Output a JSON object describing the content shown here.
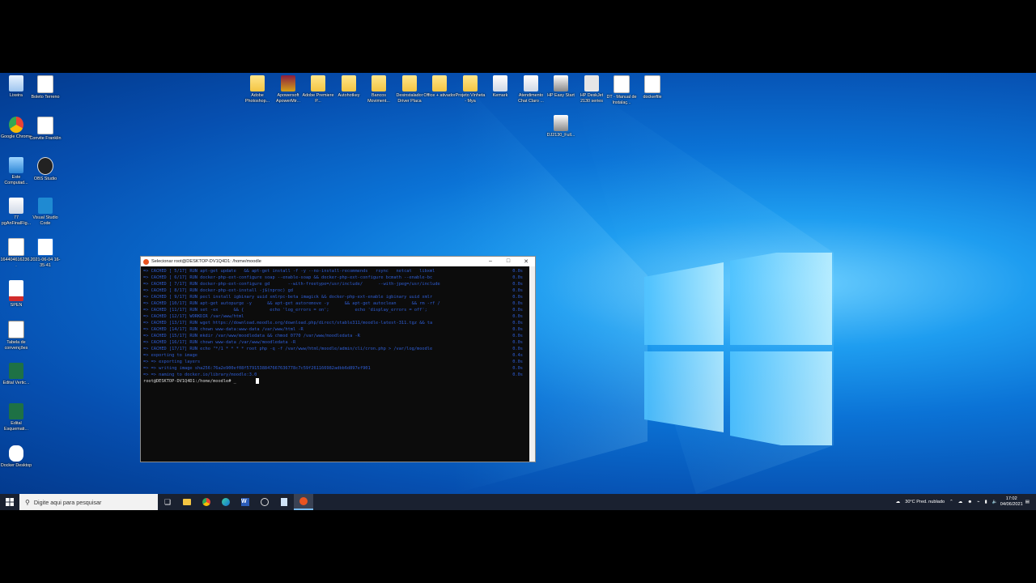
{
  "desktop_icons": [
    {
      "label": "Lixeira",
      "icon": "recycle-bin-icon"
    },
    {
      "label": "Boleto Terreno",
      "icon": "document-icon"
    },
    {
      "label": "Google Chrome",
      "icon": "chrome-icon"
    },
    {
      "label": "Convite Franklin",
      "icon": "document-icon"
    },
    {
      "label": "Este Computad...",
      "icon": "computer-icon"
    },
    {
      "label": "OBS Studio",
      "icon": "obs-icon"
    },
    {
      "label": "77 pgAnFinalFig...",
      "icon": "app-icon"
    },
    {
      "label": "Visual Studio Code",
      "icon": "vscode-icon"
    },
    {
      "label": "164404616236...",
      "icon": "document-icon"
    },
    {
      "label": "2021-06-04 16-35-41",
      "icon": "video-icon"
    },
    {
      "label": "SPEN",
      "icon": "pdf-icon"
    },
    {
      "label": "Tabela de convenções",
      "icon": "spreadsheet-icon"
    },
    {
      "label": "Edital Vertic...",
      "icon": "excel-icon"
    },
    {
      "label": "Edital Esquemati...",
      "icon": "excel-icon"
    },
    {
      "label": "Docker Desktop",
      "icon": "docker-icon"
    },
    {
      "label": "Adobe Photoshop...",
      "icon": "folder-icon"
    },
    {
      "label": "Apowersoft ApowerMir...",
      "icon": "winrar-icon"
    },
    {
      "label": "Adobe Premiere P...",
      "icon": "folder-icon"
    },
    {
      "label": "Autohotkey",
      "icon": "folder-icon"
    },
    {
      "label": "Bancos Moviment...",
      "icon": "folder-icon"
    },
    {
      "label": "Desinstalador Driver Placa",
      "icon": "folder-icon"
    },
    {
      "label": "Office + ativador",
      "icon": "folder-icon"
    },
    {
      "label": "Projeto Vinheta - Mya",
      "icon": "folder-icon"
    },
    {
      "label": "Kemark",
      "icon": "app-icon"
    },
    {
      "label": "Atendimento Chat Claro ...",
      "icon": "app-icon"
    },
    {
      "label": "HP Easy Start",
      "icon": "installer-icon"
    },
    {
      "label": "HP DeskJet 2130 series",
      "icon": "printer-icon"
    },
    {
      "label": "DT - Manual de Instalaç...",
      "icon": "document-icon"
    },
    {
      "label": "dockerfile",
      "icon": "document-icon"
    },
    {
      "label": "DJ2130_Full...",
      "icon": "installer-icon"
    }
  ],
  "terminal": {
    "title": "Selecionar root@DESKTOP-DV1Q4D1: /home/moodle",
    "lines": [
      {
        "text": "=> CACHED [ 5/17] RUN apt-get update   && apt-get install -f -y --no-install-recommends   rsync   netcat   libxml",
        "time": "0.0s"
      },
      {
        "text": "=> CACHED [ 6/17] RUN docker-php-ext-configure soap --enable-soap && docker-php-ext-configure bcmath --enable-bc",
        "time": "0.0s"
      },
      {
        "text": "=> CACHED [ 7/17] RUN docker-php-ext-configure gd       --with-freetype=/usr/include/      --with-jpeg=/usr/include",
        "time": "0.0s"
      },
      {
        "text": "=> CACHED [ 8/17] RUN docker-php-ext-install -j$(nproc) gd",
        "time": "0.0s"
      },
      {
        "text": "=> CACHED [ 9/17] RUN pecl install igbinary uuid xmlrpc-beta imagick && docker-php-ext-enable igbinary uuid xmlr",
        "time": "0.0s"
      },
      {
        "text": "=> CACHED [10/17] RUN apt-get autopurge -y      && apt-get autoremove -y      && apt-get autoclean      && rm -rf /",
        "time": "0.0s"
      },
      {
        "text": "=> CACHED [11/17] RUN set -ex      && {          echo 'log_errors = on';          echo 'display_errors = off';",
        "time": "0.0s"
      },
      {
        "text": "=> CACHED [12/17] WORKDIR /var/www/html",
        "time": "0.0s"
      },
      {
        "text": "=> CACHED [13/17] RUN wget https://download.moodle.org/download.php/direct/stable311/moodle-latest-311.tgz && ta",
        "time": "0.0s"
      },
      {
        "text": "=> CACHED [14/17] RUN chown www-data:www-data /var/www/html -R",
        "time": "0.0s"
      },
      {
        "text": "=> CACHED [15/17] RUN mkdir /var/www/moodledata && chmod 0770 /var/www/moodledata -R",
        "time": "0.0s"
      },
      {
        "text": "=> CACHED [16/17] RUN chown www-data /var/www/moodledata -R",
        "time": "0.0s"
      },
      {
        "text": "=> CACHED [17/17] RUN echo \"*/1 * * * * root php -q -f /var/www/html/moodle/admin/cli/cron.php > /var/log/moodle",
        "time": "0.0s"
      },
      {
        "text": "=> exporting to image",
        "time": "0.4s"
      },
      {
        "text": "=> => exporting layers",
        "time": "0.0s"
      },
      {
        "text": "=> => writing image sha256:76a2e900ef08f5791538847667636778c7c59f261166982adbb6d897ef901",
        "time": "0.0s"
      },
      {
        "text": "=> => naming to docker.io/library/moodle:3.0",
        "time": "0.0s"
      }
    ],
    "prompt": "root@DESKTOP-DV1Q4D1:/home/moodle# _"
  },
  "taskbar": {
    "search_placeholder": "Digite aqui para pesquisar",
    "apps": [
      "task-view-icon",
      "file-explorer-icon",
      "chrome-icon",
      "edge-icon",
      "word-icon",
      "obs-icon",
      "notepad-icon",
      "ubuntu-icon"
    ],
    "weather": "30°C  Pred. nublado",
    "time": "17:02",
    "date": "04/06/2021"
  },
  "colors": {
    "terminal_text": "#2f5ed6",
    "wallpaper": "#0b73d6",
    "taskbar": "#1a2130"
  }
}
